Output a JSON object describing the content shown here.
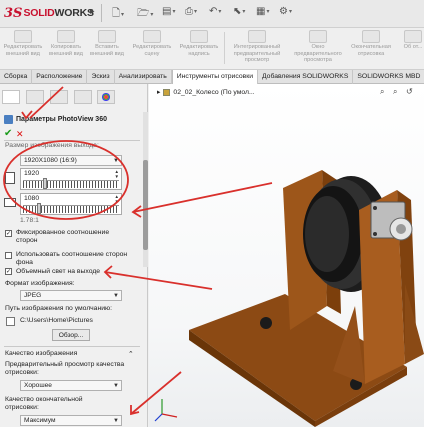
{
  "app": {
    "logo_ds": "3S",
    "logo_solid": "SOLID",
    "logo_works": "WORKS"
  },
  "ribbon": {
    "commands": [
      {
        "label": "Редактировать внешний вид",
        "icon": "edit-appearance-icon"
      },
      {
        "label": "Копировать внешний вид",
        "icon": "copy-appearance-icon"
      },
      {
        "label": "Вставить внешний вид",
        "icon": "paste-appearance-icon"
      },
      {
        "label": "Редактировать сцену",
        "icon": "edit-scene-icon"
      },
      {
        "label": "Редактировать надпись",
        "icon": "edit-decal-icon"
      },
      {
        "label": "Интегрированный предварительный просмотр",
        "icon": "integrated-preview-icon"
      },
      {
        "label": "Окно предварительного просмотра",
        "icon": "preview-window-icon"
      },
      {
        "label": "Окончательная отрисовка",
        "icon": "final-render-icon"
      },
      {
        "label": "Об от...",
        "icon": "render-region-icon"
      }
    ]
  },
  "tabs": [
    {
      "label": "Сборка"
    },
    {
      "label": "Расположение"
    },
    {
      "label": "Эскиз"
    },
    {
      "label": "Анализировать"
    },
    {
      "label": "Инструменты отрисовки"
    },
    {
      "label": "Добавления SOLIDWORKS"
    },
    {
      "label": "SOLIDWORKS MBD"
    }
  ],
  "property_manager": {
    "title": "Параметры PhotoView 360",
    "section_output_size": "Размер изображения выхода:",
    "size_preset": "1920X1080 (16:9)",
    "width_value": "1920",
    "height_value": "1080",
    "aspect_value": "1.78:1",
    "fixed_aspect_label": "Фиксированное соотношение сторон",
    "fixed_aspect_checked": true,
    "use_background_aspect_label": "Использовать соотношение сторон фона",
    "use_background_aspect_checked": false,
    "volumetric_light_label": "Объемный свет на выходе",
    "volumetric_light_checked": true,
    "image_format_label": "Формат изображения:",
    "image_format_value": "JPEG",
    "default_path_label": "Путь изображения по умолчанию:",
    "default_path_value": "C:\\Users\\Home\\Pictures",
    "browse_button": "Обзор...",
    "quality_section_label": "Качество изображения",
    "preview_quality_label": "Предварительный просмотр качества отрисовки:",
    "preview_quality_value": "Хорошее",
    "final_quality_label": "Качество окончательной отрисовки:",
    "final_quality_value": "Максимум"
  },
  "viewport": {
    "crumb": "02_02_Колесо (По умол..."
  },
  "colors": {
    "annotation_red": "#d9302c",
    "bracket_brown": "#a45a1c",
    "wheel_dark": "#262626",
    "accent_blue": "#4a7fc1"
  }
}
